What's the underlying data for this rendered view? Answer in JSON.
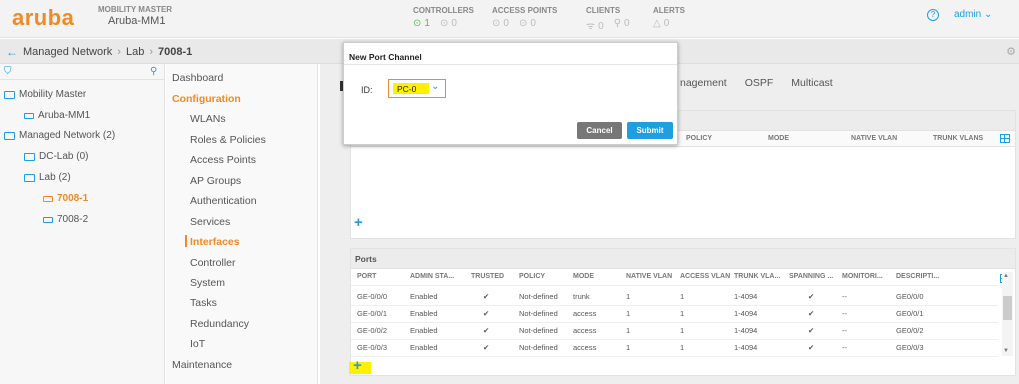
{
  "brand": {
    "logo": "aruba",
    "title": "MOBILITY MASTER",
    "name": "Aruba-MM1"
  },
  "stats": [
    {
      "label": "CONTROLLERS",
      "a": "1",
      "b": "0"
    },
    {
      "label": "ACCESS POINTS",
      "a": "0",
      "b": "0"
    },
    {
      "label": "CLIENTS",
      "a": "0",
      "b": "0"
    },
    {
      "label": "ALERTS",
      "a": "0"
    }
  ],
  "user": {
    "name": "admin"
  },
  "breadcrumb": {
    "a": "Managed Network",
    "b": "Lab",
    "c": "7008-1"
  },
  "tree": {
    "mm": "Mobility Master",
    "mm1": "Aruba-MM1",
    "managed": "Managed Network (2)",
    "dclab": "DC-Lab (0)",
    "lab": "Lab (2)",
    "d1": "7008-1",
    "d2": "7008-2"
  },
  "menu": {
    "dashboard": "Dashboard",
    "configuration": "Configuration",
    "wlans": "WLANs",
    "roles": "Roles & Policies",
    "aps": "Access Points",
    "apgroups": "AP Groups",
    "auth": "Authentication",
    "services": "Services",
    "interfaces": "Interfaces",
    "controller": "Controller",
    "system": "System",
    "tasks": "Tasks",
    "redundancy": "Redundancy",
    "iot": "IoT",
    "maintenance": "Maintenance"
  },
  "tabs": {
    "t1": "nagement",
    "t2": "OSPF",
    "t3": "Multicast"
  },
  "pc_table": {
    "h1": "POLICY",
    "h2": "MODE",
    "h3": "NATIVE VLAN",
    "h4": "TRUNK VLANS"
  },
  "ports": {
    "title": "Ports",
    "headers": [
      "PORT",
      "ADMIN STA...",
      "TRUSTED",
      "POLICY",
      "MODE",
      "NATIVE VLAN",
      "ACCESS VLAN",
      "TRUNK VLA...",
      "SPANNING ...",
      "MONITORI...",
      "DESCRIPTI..."
    ],
    "rows": [
      [
        "GE-0/0/0",
        "Enabled",
        "✔",
        "Not-defined",
        "trunk",
        "1",
        "1",
        "1-4094",
        "✔",
        "--",
        "GE0/0/0"
      ],
      [
        "GE-0/0/1",
        "Enabled",
        "✔",
        "Not-defined",
        "access",
        "1",
        "1",
        "1-4094",
        "✔",
        "--",
        "GE0/0/1"
      ],
      [
        "GE-0/0/2",
        "Enabled",
        "✔",
        "Not-defined",
        "access",
        "1",
        "1",
        "1-4094",
        "✔",
        "--",
        "GE0/0/2"
      ],
      [
        "GE-0/0/3",
        "Enabled",
        "✔",
        "Not-defined",
        "access",
        "1",
        "1",
        "1-4094",
        "✔",
        "--",
        "GE0/0/3"
      ]
    ]
  },
  "modal": {
    "title": "New Port Channel",
    "id_label": "ID:",
    "id_value": "PC-0",
    "cancel": "Cancel",
    "submit": "Submit"
  },
  "colors": {
    "accent": "#f08a24",
    "link": "#1e9fe0",
    "highlight": "#ffef00"
  }
}
